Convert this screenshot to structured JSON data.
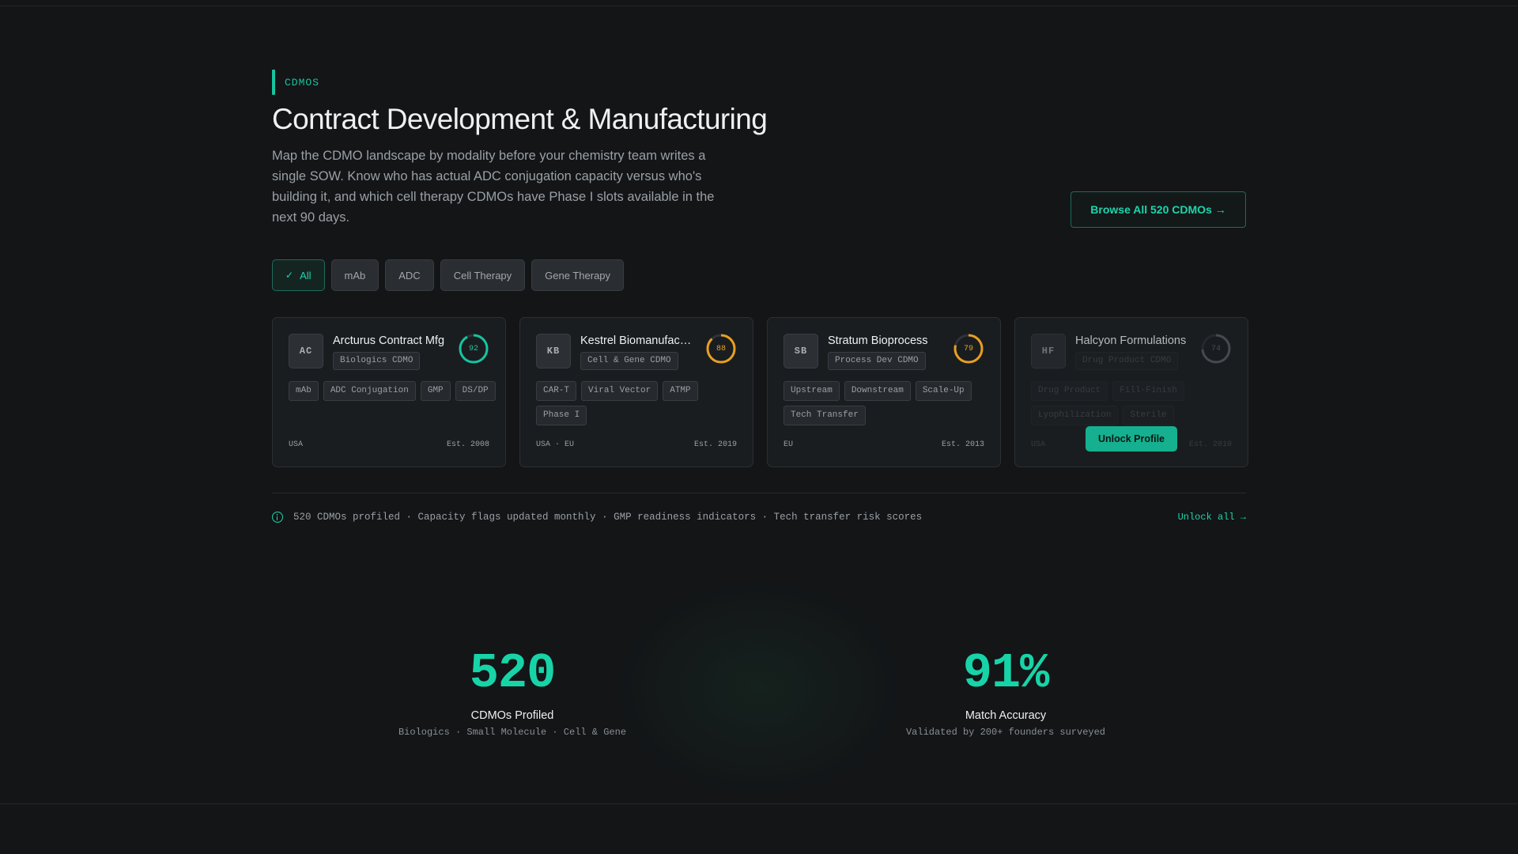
{
  "section": {
    "eyebrow": "CDMOS"
  },
  "header": {
    "title": "Contract Development & Manufacturing",
    "description": "Map the CDMO landscape by modality before your chemistry team writes a single SOW. Know who has actual ADC conjugation capacity versus who's building it, and which cell therapy CDMOs have Phase I slots available in the next 90 days.",
    "browse_button": "Browse All 520 CDMOs →"
  },
  "filters": [
    {
      "label": "All",
      "active": true
    },
    {
      "label": "mAb",
      "active": false
    },
    {
      "label": "ADC",
      "active": false
    },
    {
      "label": "Cell Therapy",
      "active": false
    },
    {
      "label": "Gene Therapy",
      "active": false
    }
  ],
  "cards": [
    {
      "initials": "AC",
      "name": "Arcturus Contract Mfg",
      "type": "Biologics CDMO",
      "score": 92,
      "score_color": "#17c4a0",
      "tags": [
        "mAb",
        "ADC Conjugation",
        "GMP",
        "DS/DP"
      ],
      "region": "USA",
      "established": "Est. 2008",
      "locked": false
    },
    {
      "initials": "KB",
      "name": "Kestrel Biomanufacturing",
      "type": "Cell & Gene CDMO",
      "score": 88,
      "score_color": "#e8a020",
      "tags": [
        "CAR-T",
        "Viral Vector",
        "ATMP",
        "Phase I"
      ],
      "region": "USA · EU",
      "established": "Est. 2019",
      "locked": false
    },
    {
      "initials": "SB",
      "name": "Stratum Bioprocess",
      "type": "Process Dev CDMO",
      "score": 79,
      "score_color": "#e8a020",
      "tags": [
        "Upstream",
        "Downstream",
        "Scale-Up",
        "Tech Transfer"
      ],
      "region": "EU",
      "established": "Est. 2013",
      "locked": false
    },
    {
      "initials": "HF",
      "name": "Halcyon Formulations",
      "type": "Drug Product CDMO",
      "score": 74,
      "score_color": "#6b7075",
      "tags": [
        "Drug Product",
        "Fill-Finish",
        "Lyophilization",
        "Sterile"
      ],
      "region": "USA",
      "established": "Est. 2010",
      "locked": true,
      "unlock_label": "Unlock Profile"
    }
  ],
  "infobar": {
    "text": "520 CDMOs profiled · Capacity flags updated monthly · GMP readiness indicators · Tech transfer risk scores",
    "unlock_all": "Unlock all →"
  },
  "stats": [
    {
      "value": "520",
      "label": "CDMOs Profiled",
      "sub": "Biologics · Small Molecule · Cell & Gene"
    },
    {
      "value": "91%",
      "label": "Match Accuracy",
      "sub": "Validated by 200+ founders surveyed"
    }
  ],
  "colors": {
    "accent": "#17c4a0",
    "warning": "#e8a020",
    "background": "#131517"
  }
}
